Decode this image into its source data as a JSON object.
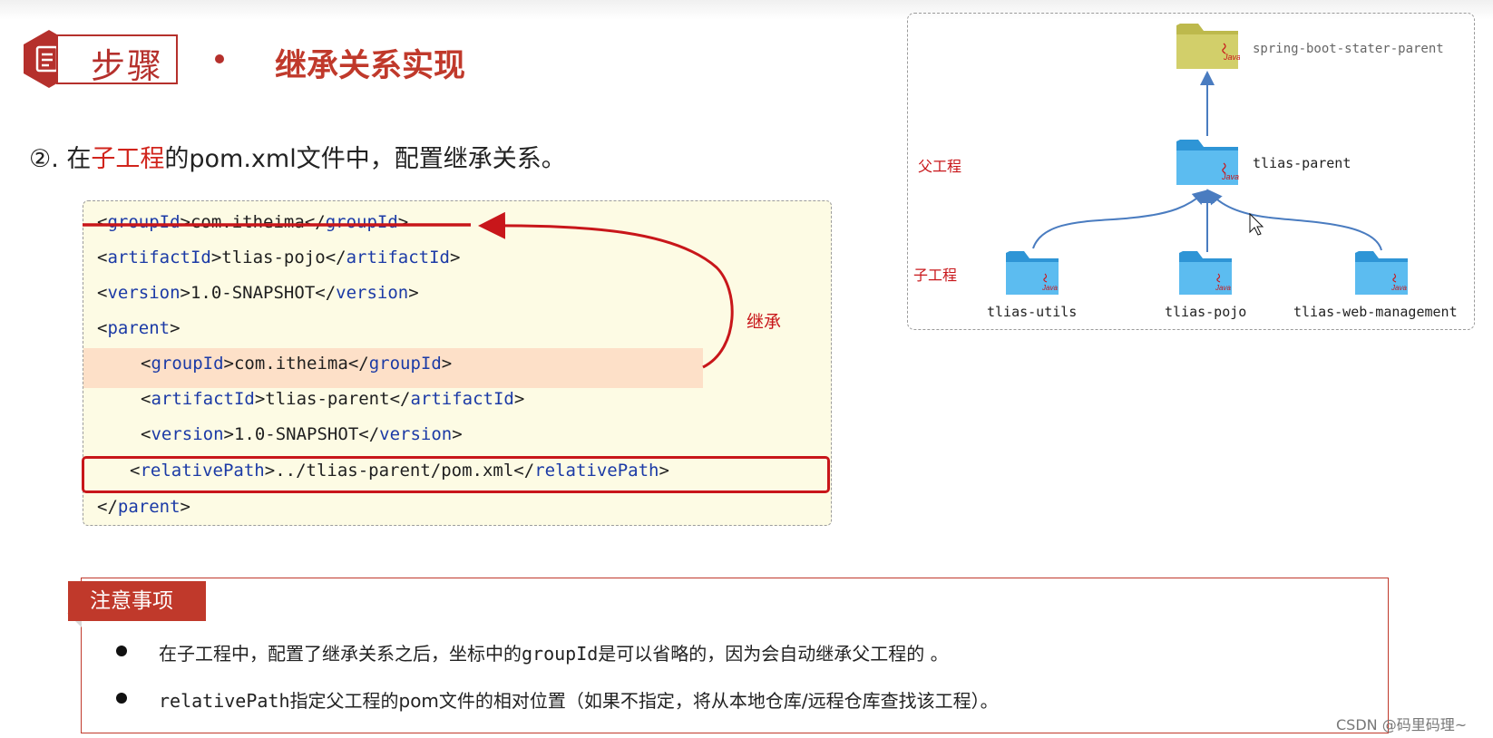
{
  "header": {
    "step_label": "步骤",
    "title": "继承关系实现"
  },
  "instruction": {
    "prefix": "②. 在",
    "highlight": "子工程",
    "suffix": "的pom.xml文件中，配置继承关系。"
  },
  "code": {
    "lines": [
      {
        "indent": "",
        "tag": "groupId",
        "value": "com.itheima"
      },
      {
        "indent": "",
        "tag": "artifactId",
        "value": "tlias-pojo"
      },
      {
        "indent": "",
        "tag": "version",
        "value": "1.0-SNAPSHOT"
      },
      {
        "indent": "",
        "open_tag": "parent"
      },
      {
        "indent": "    ",
        "tag": "groupId",
        "value": "com.itheima"
      },
      {
        "indent": "    ",
        "tag": "artifactId",
        "value": "tlias-parent"
      },
      {
        "indent": "    ",
        "tag": "version",
        "value": "1.0-SNAPSHOT"
      },
      {
        "indent": "   ",
        "tag": "relativePath",
        "value": "../tlias-parent/pom.xml"
      },
      {
        "indent": "",
        "close_tag": "parent"
      }
    ],
    "inherit_label": "继承"
  },
  "diagram": {
    "parent_label": "父工程",
    "child_label": "子工程",
    "root": "spring-boot-stater-parent",
    "parent": "tlias-parent",
    "children": [
      "tlias-utils",
      "tlias-pojo",
      "tlias-web-management"
    ],
    "folder_badge": "Java",
    "colors": {
      "root_folder": "#c8c55f",
      "child_folder": "#4eb3ea",
      "arrow": "#4a7cc0"
    }
  },
  "notes": {
    "title": "注意事项",
    "items": [
      {
        "pre": "在子工程中，配置了继承关系之后，坐标中的",
        "code": "groupId",
        "post": "是可以省略的，因为会自动继承父工程的 。"
      },
      {
        "pre": "",
        "code": "relativePath",
        "post": "指定父工程的pom文件的相对位置（如果不指定，将从本地仓库/远程仓库查找该工程）。"
      }
    ]
  },
  "watermark": "CSDN @码里码理~"
}
